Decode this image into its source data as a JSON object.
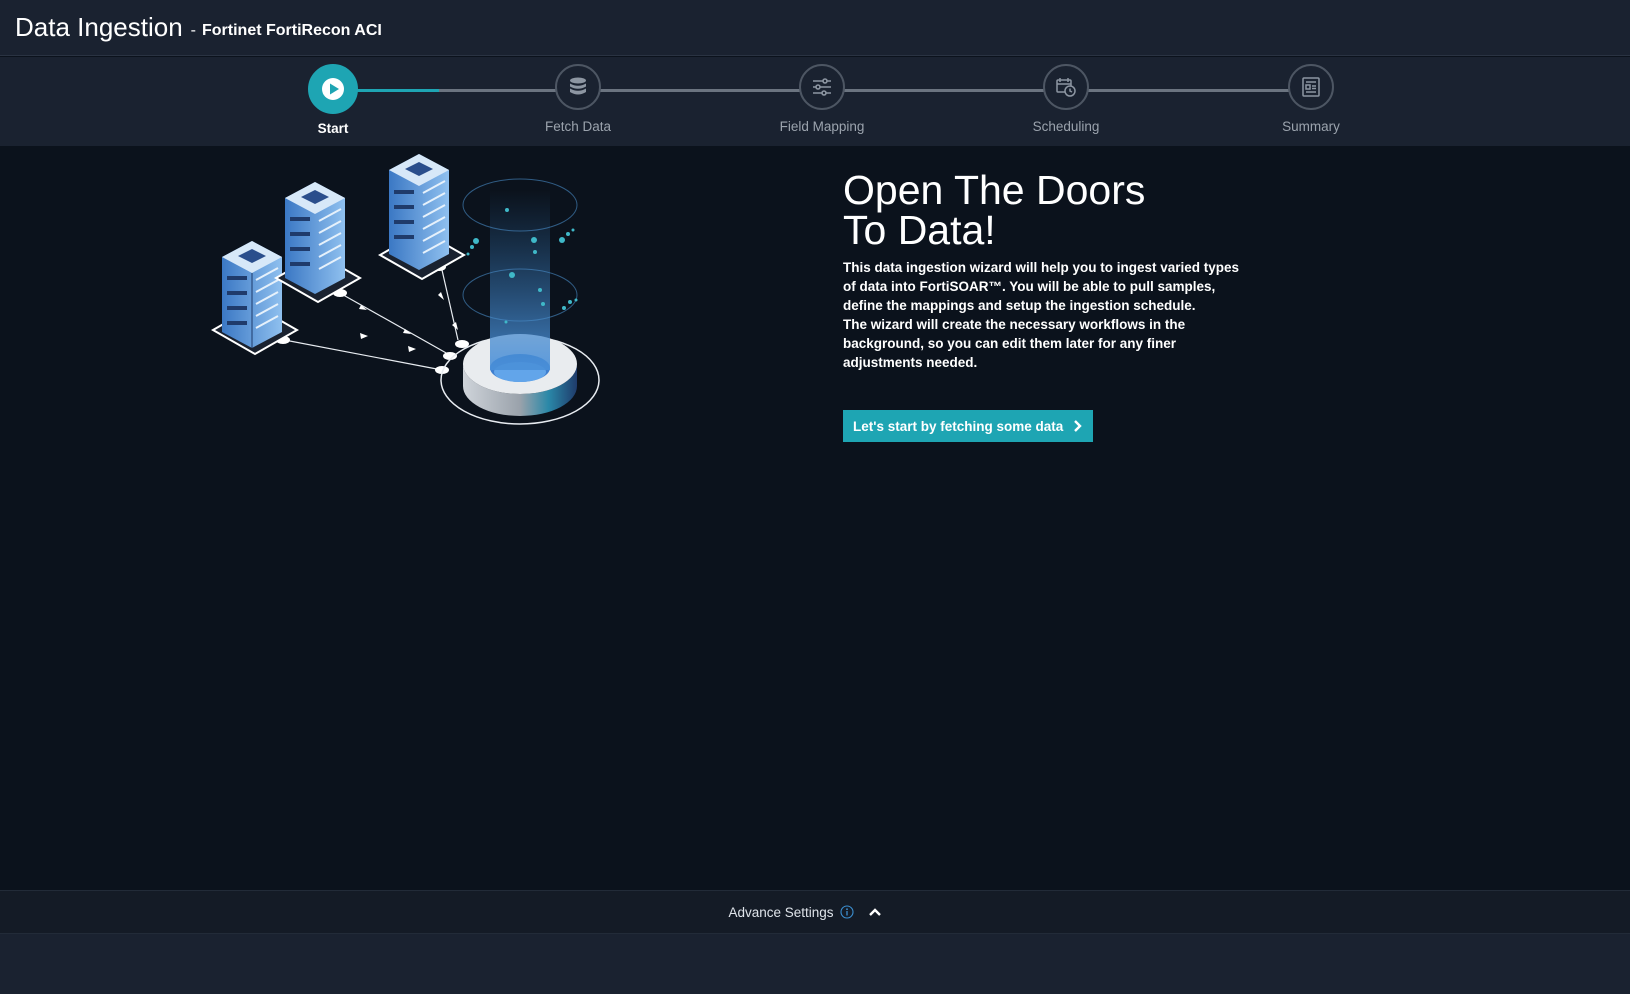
{
  "header": {
    "title": "Data Ingestion",
    "separator": "-",
    "subtitle": "Fortinet FortiRecon ACI"
  },
  "wizard": {
    "steps": [
      {
        "label": "Start",
        "icon": "play-icon",
        "active": true
      },
      {
        "label": "Fetch Data",
        "icon": "database-icon",
        "active": false
      },
      {
        "label": "Field Mapping",
        "icon": "sliders-icon",
        "active": false
      },
      {
        "label": "Scheduling",
        "icon": "calendar-clock-icon",
        "active": false
      },
      {
        "label": "Summary",
        "icon": "document-icon",
        "active": false
      }
    ],
    "progress": 0.37,
    "colors": {
      "accent": "#1ea5b3",
      "inactive": "#6b7480"
    }
  },
  "hero": {
    "title_line1": "Open The Doors",
    "title_line2": "To Data!",
    "paragraph1": "This data ingestion wizard will help you to ingest varied types of data into FortiSOAR™. You will be able to pull samples, define the mappings and setup the ingestion schedule.",
    "paragraph2": "The wizard will create the necessary workflows in the background, so you can edit them later for any finer adjustments needed.",
    "cta_label": "Let's start by fetching some data",
    "illustration": "servers-to-database-illustration"
  },
  "advanced": {
    "label": "Advance Settings",
    "info_icon": "info-icon",
    "toggle_icon": "chevron-up-icon"
  }
}
